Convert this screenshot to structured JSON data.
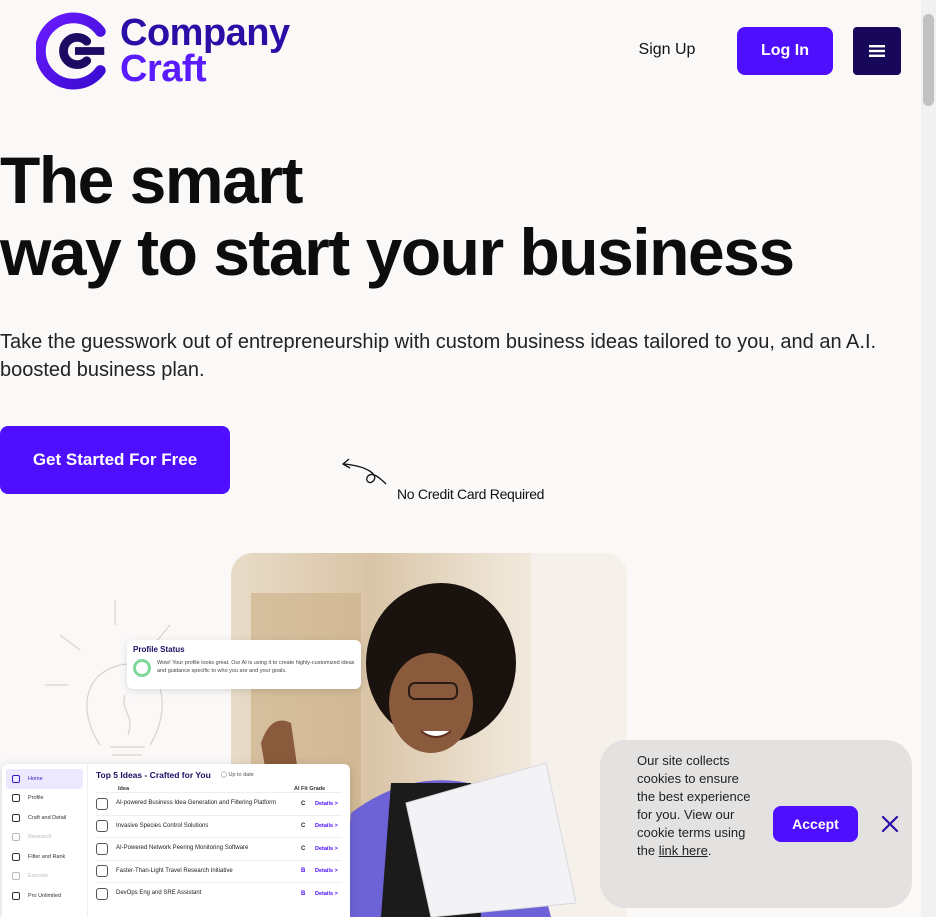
{
  "brand": {
    "name_line1": "Company",
    "name_line2": "Craft",
    "accent": "#4f0fff",
    "dark_accent": "#17085a"
  },
  "nav": {
    "signup_label": "Sign Up",
    "login_label": "Log In",
    "menu_icon": "hamburger-icon"
  },
  "hero": {
    "title_line1": "The smart",
    "title_line2": "way to start your business",
    "subtitle": "Take the guesswork out of entrepreneurship with custom business ideas tailored to you, and an A.I. boosted business plan.",
    "cta_label": "Get Started For Free",
    "note": "No Credit Card Required"
  },
  "profile_card": {
    "title": "Profile Status",
    "text": "Wow! Your profile looks great. Our AI is using it to create highly-customized ideas and guidance specific to who you are and your goals."
  },
  "dashboard": {
    "sidebar": [
      {
        "label": "Home"
      },
      {
        "label": "Profile"
      },
      {
        "label": "Craft and Detail"
      },
      {
        "label": "Research"
      },
      {
        "label": "Filter and Rank"
      },
      {
        "label": "Execute"
      },
      {
        "label": "Pro Unlimited"
      }
    ],
    "title": "Top 5 Ideas - Crafted for You",
    "status": "Up to date",
    "col_idea": "Idea",
    "col_grade": "AI Fit Grade",
    "rows": [
      {
        "name": "AI-powered Business Idea Generation and Filtering Platform",
        "grade": "C",
        "details": "Details >"
      },
      {
        "name": "Invasive Species Control Solutions",
        "grade": "C",
        "details": "Details >"
      },
      {
        "name": "AI-Powered Network Peering Monitoring Software",
        "grade": "C",
        "details": "Details >"
      },
      {
        "name": "Faster-Than-Light Travel Research Initiative",
        "grade": "B",
        "details": "Details >"
      },
      {
        "name": "DevOps Eng and SRE Assistant",
        "grade": "B",
        "details": "Details >"
      }
    ]
  },
  "cookie": {
    "text": "Our site collects cookies to ensure the best experience for you. View our cookie terms using the",
    "link_label": "link here",
    "after_link": ".",
    "accept_label": "Accept",
    "close_icon": "close-icon"
  }
}
